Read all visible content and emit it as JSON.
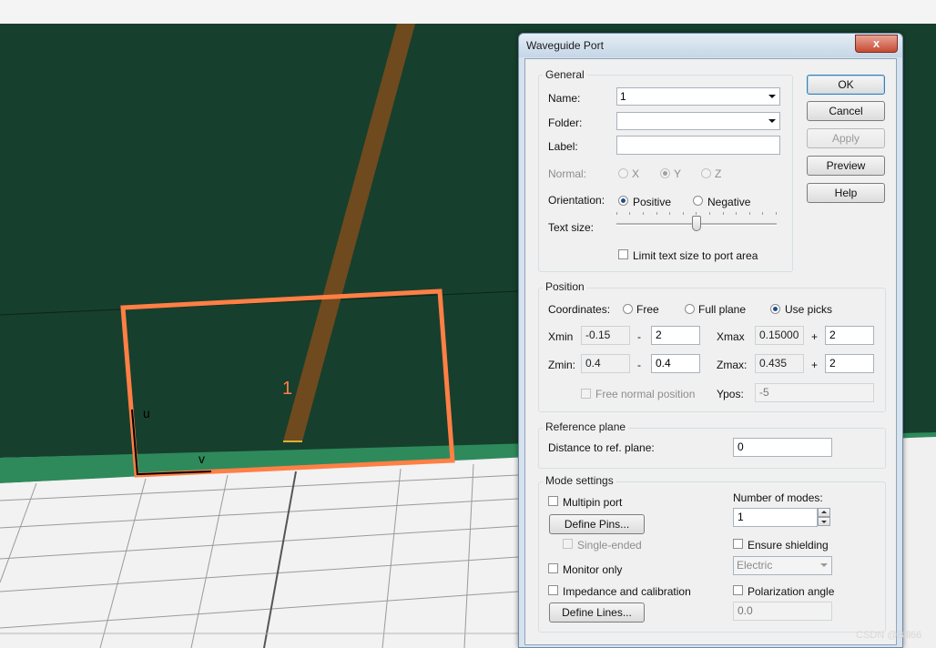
{
  "viewport": {
    "port_label": "1",
    "axis_u": "u",
    "axis_v": "v"
  },
  "dialog": {
    "title": "Waveguide Port",
    "close_glyph": "x",
    "buttons": {
      "ok": "OK",
      "cancel": "Cancel",
      "apply": "Apply",
      "preview": "Preview",
      "help": "Help"
    },
    "general": {
      "title": "General",
      "name_label": "Name:",
      "name_value": "1",
      "folder_label": "Folder:",
      "folder_value": "",
      "label_label": "Label:",
      "label_value": "",
      "normal_label": "Normal:",
      "normal_options": [
        "X",
        "Y",
        "Z"
      ],
      "normal_selected": "Y",
      "orientation_label": "Orientation:",
      "orientation_options": [
        "Positive",
        "Negative"
      ],
      "orientation_selected": "Positive",
      "textsize_label": "Text size:",
      "textsize_level": 0.5,
      "limit_text_label": "Limit text size to port area",
      "limit_text_checked": false
    },
    "position": {
      "title": "Position",
      "coordinates_label": "Coordinates:",
      "coordinate_options": [
        "Free",
        "Full plane",
        "Use picks"
      ],
      "coordinate_selected": "Use picks",
      "xmin_label": "Xmin",
      "xmin_value": "-0.15",
      "xmin_sign": "-",
      "xmin_offset": "2",
      "xmax_label": "Xmax",
      "xmax_value": "0.15000",
      "xmax_sign": "+",
      "xmax_offset": "2",
      "zmin_label": "Zmin:",
      "zmin_value": "0.4",
      "zmin_sign": "-",
      "zmin_offset": "0.4",
      "zmax_label": "Zmax:",
      "zmax_value": "0.435",
      "zmax_sign": "+",
      "zmax_offset": "2",
      "free_normal_label": "Free normal position",
      "ypos_label": "Ypos:",
      "ypos_value": "-5"
    },
    "reference": {
      "title": "Reference plane",
      "distance_label": "Distance to ref. plane:",
      "distance_value": "0"
    },
    "modes": {
      "title": "Mode settings",
      "multipin_label": "Multipin port",
      "define_pins": "Define Pins...",
      "single_ended_label": "Single-ended",
      "monitor_only_label": "Monitor only",
      "impedance_label": "Impedance and calibration",
      "define_lines": "Define Lines...",
      "num_modes_label": "Number of modes:",
      "num_modes_value": "1",
      "ensure_shielding_label": "Ensure shielding",
      "shielding_value": "Electric",
      "polarization_label": "Polarization angle",
      "polarization_value": "0.0"
    }
  },
  "watermark": "CSDN @Bill66",
  "colors": {
    "substrate": "#173f2d",
    "ground_band": "#2e8a5b",
    "port_frame": "#ff7f45",
    "strip": "#6e4a1e",
    "dialog_frame": "#d6e2ee"
  }
}
